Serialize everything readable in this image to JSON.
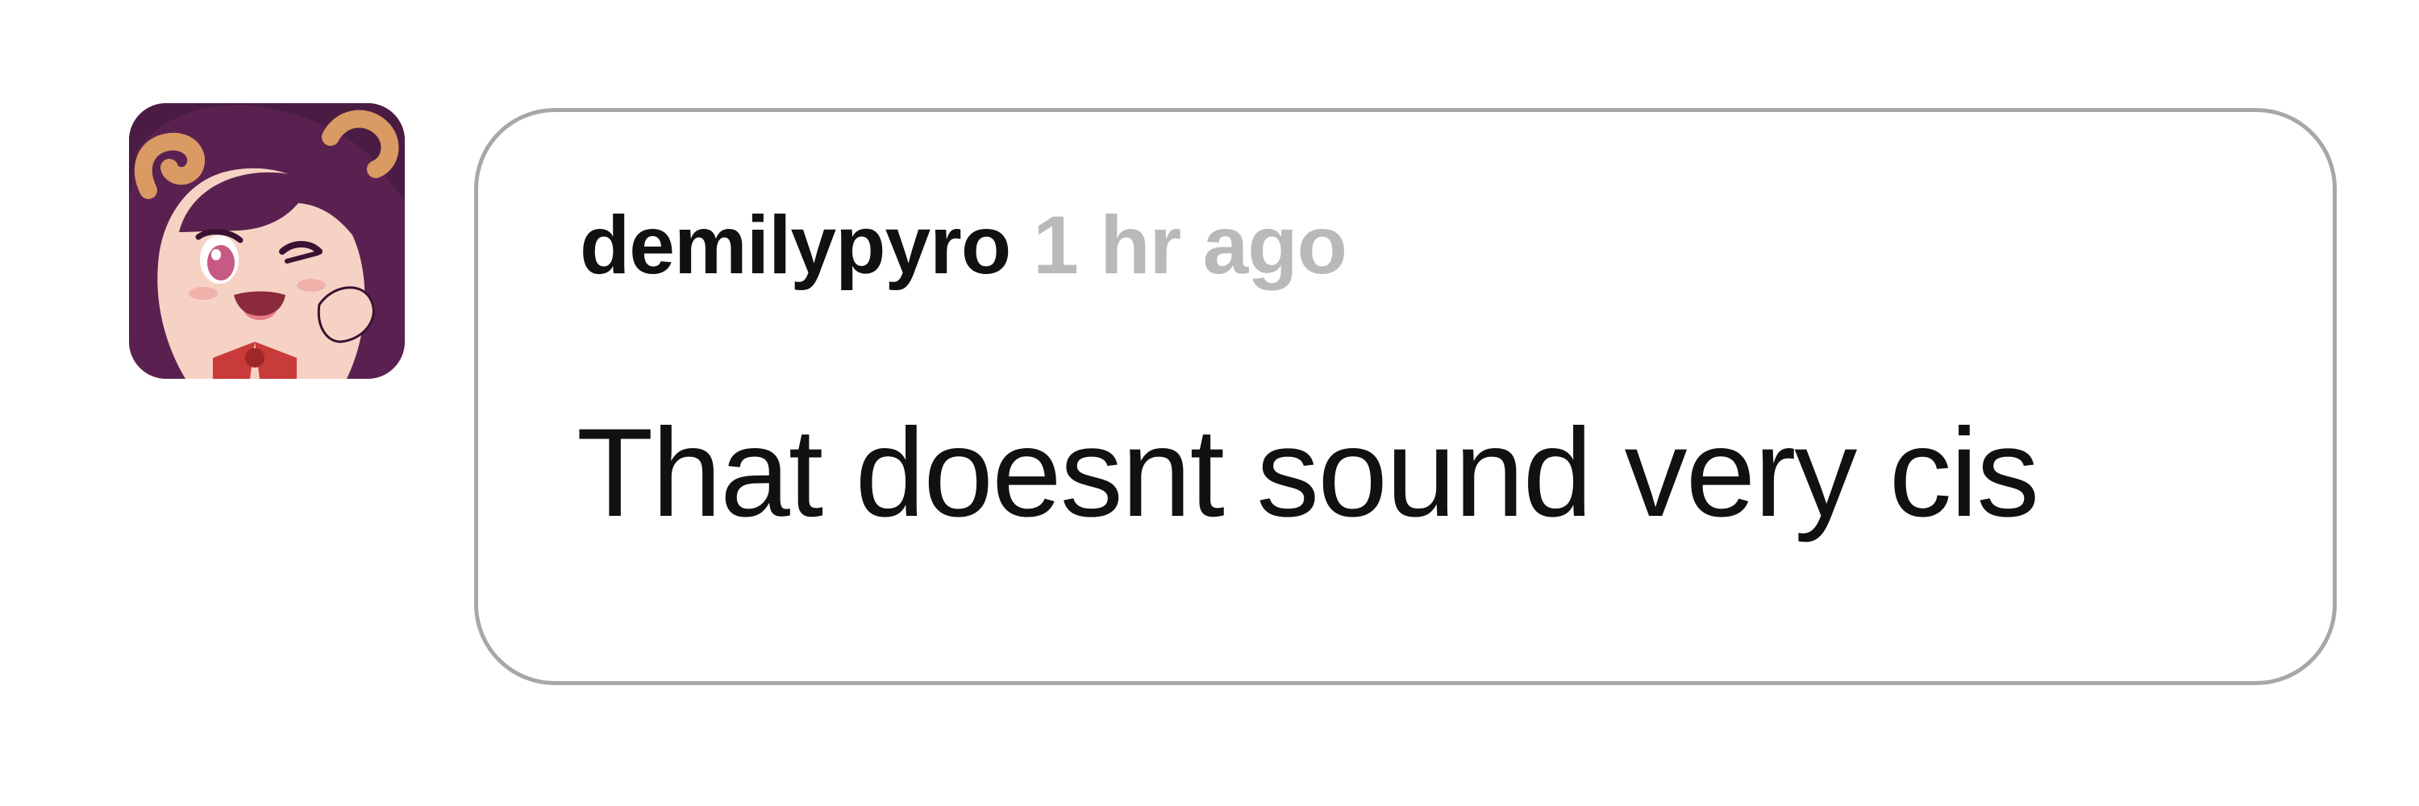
{
  "comment": {
    "username": "demilypyro",
    "timestamp": "1 hr ago",
    "text": "That doesnt sound very cis"
  },
  "avatar": {
    "icon": "user-avatar-illustration",
    "colors": {
      "hair": "#5a2150",
      "skin": "#f6d2c4",
      "horn": "#d99a63",
      "accent": "#c93a3a",
      "eye": "#c75a84"
    }
  },
  "colors": {
    "bubble_border": "#a7a7a7",
    "username_text": "#111111",
    "timestamp_text": "#b9b9b9",
    "body_text": "#111111",
    "background": "#ffffff"
  }
}
